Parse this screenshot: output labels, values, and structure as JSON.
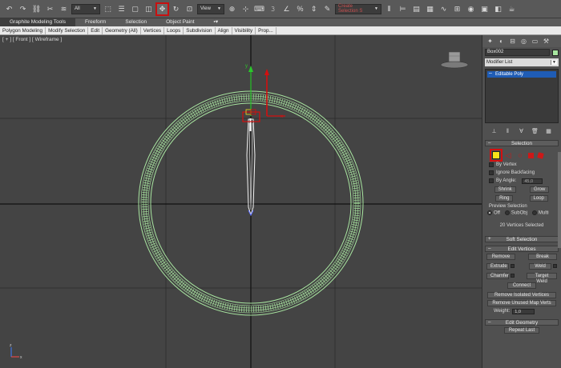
{
  "toolbar": {
    "selection_filter": "All",
    "ref_coord": "View",
    "named_selection": "Create Selection S"
  },
  "ribbon": {
    "tabs": [
      "Graphite Modeling Tools",
      "Freeform",
      "Selection",
      "Object Paint"
    ],
    "sub_items": [
      "Polygon Modeling",
      "Modify Selection",
      "Edit",
      "Geometry (All)",
      "Vertices",
      "Loops",
      "Subdivision",
      "Align",
      "Visibility",
      "Prop..."
    ]
  },
  "viewport": {
    "label": "[ + ] [ Front ] [ Wireframe ]",
    "ring_color": "#a8e6a0",
    "selection_color": "#d40f0f"
  },
  "command_panel": {
    "object_name": "Box002",
    "modifier_list": "Modifier List",
    "stack_item": "Editable Poly",
    "selection": {
      "title": "Selection",
      "by_vertex": "By Vertex",
      "ignore_backfacing": "Ignore Backfacing",
      "by_angle": "By Angle:",
      "by_angle_value": "45,0",
      "shrink": "Shrink",
      "grow": "Grow",
      "ring": "Ring",
      "loop": "Loop",
      "preview_label": "Preview Selection",
      "preview_off": "Off",
      "preview_subobj": "SubObj",
      "preview_multi": "Multi",
      "status": "20 Vertices Selected"
    },
    "soft_selection": "Soft Selection",
    "edit_vertices": {
      "title": "Edit Vertices",
      "remove": "Remove",
      "break": "Break",
      "extrude": "Extrude",
      "weld": "Weld",
      "chamfer": "Chamfer",
      "target_weld": "Target Weld",
      "connect": "Connect",
      "remove_isolated": "Remove Isolated Vertices",
      "remove_unused": "Remove Unused Map Verts",
      "weight_label": "Weight:",
      "weight_value": "1,0"
    },
    "edit_geometry": "Edit Geometry",
    "repeat_last": "Repeat Last"
  }
}
